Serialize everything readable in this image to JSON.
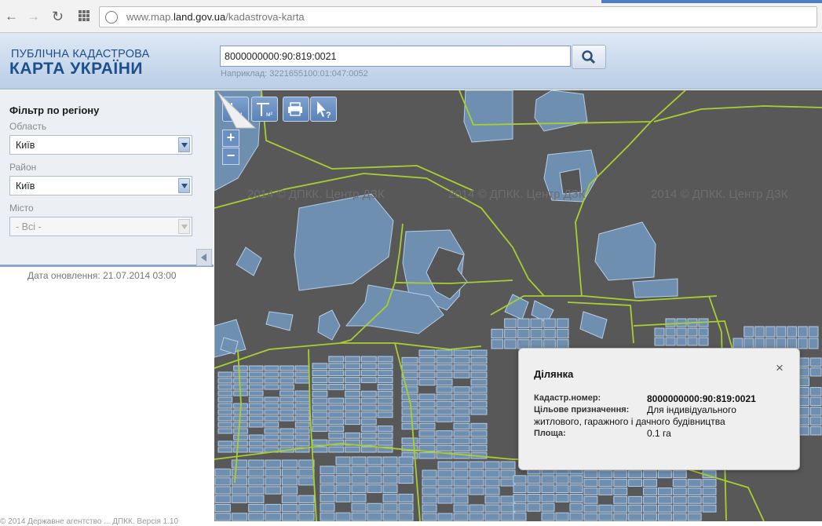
{
  "browser": {
    "back_icon": "back-arrow-icon",
    "forward_icon": "forward-arrow-icon",
    "reload_icon": "reload-icon",
    "apps_icon": "apps-grid-icon",
    "url_prefix": "www.map.",
    "url_domain": "land.gov.ua",
    "url_path": "/kadastrova-karta"
  },
  "header": {
    "logo_line1": "ПУБЛІЧНА КАДАСТРОВА",
    "logo_line2": "КАРТА УКРАЇНИ",
    "search_value": "8000000000:90:819:0021",
    "search_hint": "Наприклад: 3221655100:01:047:0052"
  },
  "filter": {
    "title": "Фільтр по регіону",
    "oblast_label": "Область",
    "oblast_value": "Київ",
    "rayon_label": "Район",
    "rayon_value": "Київ",
    "misto_label": "Місто",
    "misto_value": "- Всі -"
  },
  "sidebar": {
    "update_date": "Дата оновлення: 21.07.2014 03:00",
    "footer": "© 2014 Державне агентство ... ДПКК. Версія 1.10"
  },
  "map": {
    "tools": [
      {
        "name": "measure-distance-tool",
        "label": "м"
      },
      {
        "name": "measure-area-tool",
        "label": "м²"
      },
      {
        "name": "print-tool",
        "label": ""
      },
      {
        "name": "identify-tool",
        "label": "?"
      }
    ],
    "zoom_in": "+",
    "zoom_out": "−",
    "watermarks": [
      "2014 © ДПКК. Центр ДЗК",
      "2014 © ДПКК. Центр ДЗК",
      "2014 © ДПКК. Центр ДЗК"
    ],
    "colors": {
      "background": "#585858",
      "parcel_fill": "#6f8fb0",
      "parcel_stroke": "#b4cde6",
      "boundary": "#a8cf2e"
    }
  },
  "popup": {
    "title": "Ділянка",
    "close": "×",
    "fields": [
      {
        "key": "Кадастр.номер:",
        "value": "8000000000:90:819:0021"
      },
      {
        "key": "Цільове призначення:",
        "value": "Для індивідуального житлового, гаражного і дачного будівництва"
      },
      {
        "key": "Площа:",
        "value": "0.1 га"
      }
    ]
  }
}
